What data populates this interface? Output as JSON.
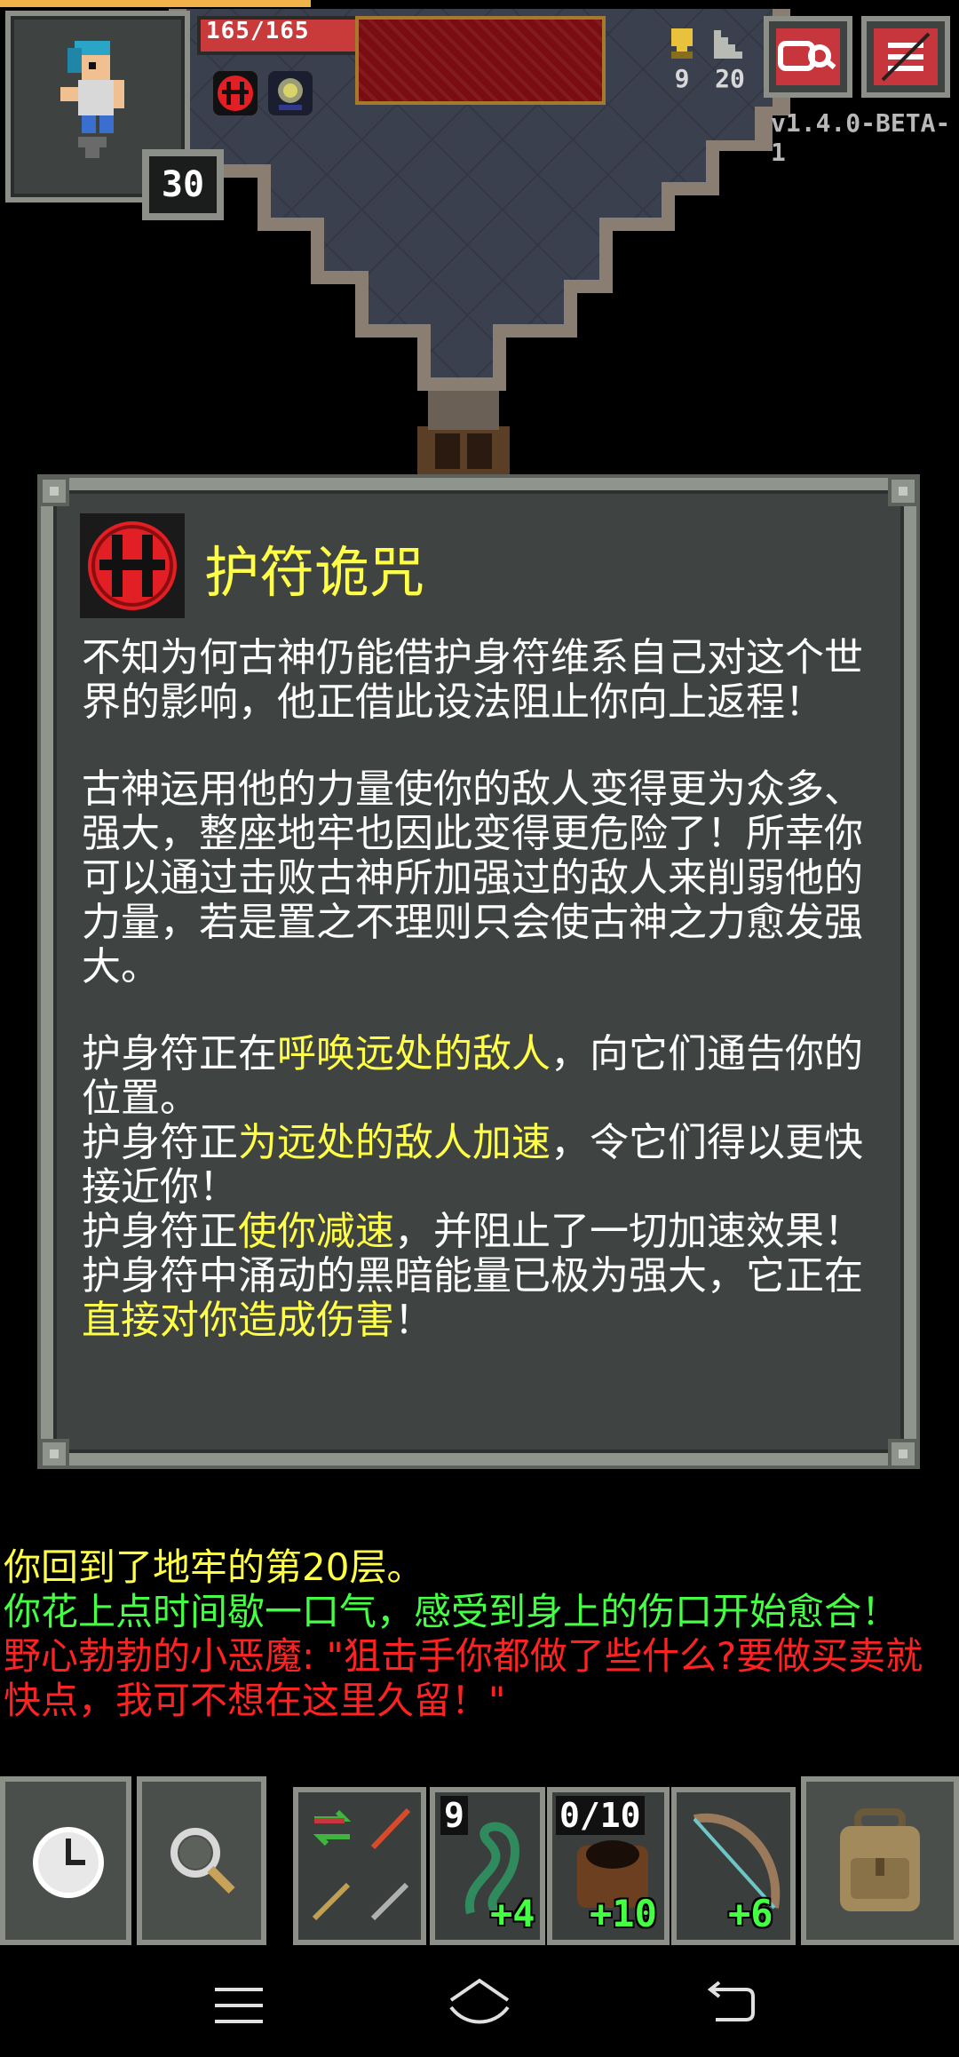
{
  "hud": {
    "hp_text": "165/165",
    "hp_fraction": 1.0,
    "hero_level": "30",
    "stat_keys": "9",
    "stat_depth": "20",
    "journal_icon": "journal-icon",
    "menu_icon": "menu-icon",
    "version": "v1.4.0-BETA-1"
  },
  "dialog": {
    "title": "护符诡咒",
    "icon": "amulet-curse-icon",
    "p1": "不知为何古神仍能借护身符维系自己对这个世界的影响，他正借此设法阻止你向上返程！",
    "p2": "古神运用他的力量使你的敌人变得更为众多、强大，整座地牢也因此变得更危险了！所幸你可以通过击败古神所加强过的敌人来削弱他的力量，若是置之不理则只会使古神之力愈发强大。",
    "p3_a": "护身符正在",
    "p3_b": "呼唤远处的敌人",
    "p3_c": "，向它们通告你的位置。",
    "p4_a": "护身符正",
    "p4_b": "为远处的敌人加速",
    "p4_c": "，令它们得以更快接近你！",
    "p5_a": "护身符正",
    "p5_b": "使你减速",
    "p5_c": "，并阻止了一切加速效果！",
    "p6_a": "护身符中涌动的黑暗能量已极为强大，它正在",
    "p6_b": "直接对你造成伤害",
    "p6_c": "！"
  },
  "log": [
    {
      "text": "你回到了地牢的第20层。",
      "color": "yellow"
    },
    {
      "text": "你花上点时间歇一口气，感受到身上的伤口开始愈合！",
      "color": "green"
    },
    {
      "text": "野心勃勃的小恶魔: \"狙击手你都做了些什么?要做买卖就快点，我可不想在这里久留！\"",
      "color": "red"
    }
  ],
  "toolbar": {
    "wait_icon": "clock-icon",
    "search_icon": "magnifier-icon",
    "qs1_count": "9",
    "qs1_bonus": "+4",
    "qs2_count": "0/10",
    "qs2_bonus": "+10",
    "qs3_bonus": "+6",
    "backpack_icon": "backpack-icon"
  },
  "colors": {
    "highlight": "#ffff47",
    "log_green": "#44ff44",
    "log_red": "#ff2222",
    "hp": "#c93a3a"
  }
}
